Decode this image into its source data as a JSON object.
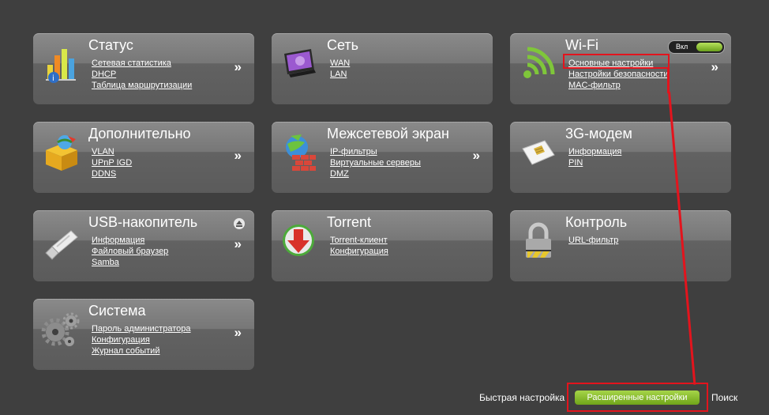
{
  "tiles": {
    "status": {
      "title": "Статус",
      "links": [
        "Сетевая статистика",
        "DHCP",
        "Таблица маршрутизации"
      ],
      "more": "»"
    },
    "network": {
      "title": "Сеть",
      "links": [
        "WAN",
        "LAN"
      ]
    },
    "wifi": {
      "title": "Wi-Fi",
      "toggle": "Вкл",
      "links": [
        "Основные настройки",
        "Настройки безопасности",
        "MAC-фильтр"
      ],
      "more": "»"
    },
    "advanced": {
      "title": "Дополнительно",
      "links": [
        "VLAN",
        "UPnP IGD",
        "DDNS"
      ],
      "more": "»"
    },
    "firewall": {
      "title": "Межсетевой экран",
      "links": [
        "IP-фильтры",
        "Виртуальные серверы",
        "DMZ"
      ],
      "more": "»"
    },
    "modem3g": {
      "title": "3G-модем",
      "links": [
        "Информация",
        "PIN"
      ]
    },
    "usb": {
      "title": "USB-накопитель",
      "links": [
        "Информация",
        "Файловый браузер",
        "Samba"
      ],
      "more": "»"
    },
    "torrent": {
      "title": "Torrent",
      "links": [
        "Torrent-клиент",
        "Конфигурация"
      ]
    },
    "control": {
      "title": "Контроль",
      "links": [
        "URL-фильтр"
      ]
    },
    "system": {
      "title": "Система",
      "links": [
        "Пароль администратора",
        "Конфигурация",
        "Журнал событий"
      ],
      "more": "»"
    }
  },
  "footer": {
    "quick_setup": "Быстрая настройка",
    "advanced_settings": "Расширенные настройки",
    "search": "Поиск"
  },
  "colors": {
    "background": "#3f3f3f",
    "highlight": "#e3141d",
    "accent_green": "#8dc63f"
  }
}
